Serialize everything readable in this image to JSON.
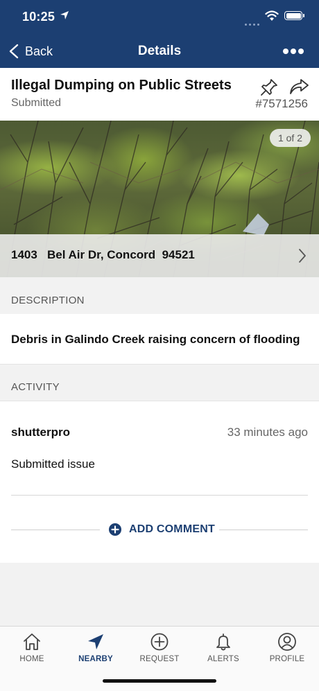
{
  "status_bar": {
    "time": "10:25"
  },
  "nav": {
    "back_label": "Back",
    "title": "Details"
  },
  "issue": {
    "title": "Illegal Dumping on Public Streets",
    "status": "Submitted",
    "ticket_number": "#7571256"
  },
  "photo": {
    "counter": "1 of 2",
    "address": "1403   Bel Air Dr, Concord  94521"
  },
  "description": {
    "label": "DESCRIPTION",
    "text": "Debris in Galindo Creek raising concern of flooding"
  },
  "activity": {
    "label": "ACTIVITY",
    "entries": [
      {
        "user": "shutterpro",
        "time": "33 minutes ago",
        "action": "Submitted issue"
      }
    ],
    "add_comment_label": "ADD COMMENT"
  },
  "tabs": [
    {
      "label": "HOME",
      "icon": "house-icon",
      "active": false
    },
    {
      "label": "NEARBY",
      "icon": "navigation-arrow-icon",
      "active": true
    },
    {
      "label": "REQUEST",
      "icon": "plus-circle-icon",
      "active": false
    },
    {
      "label": "ALERTS",
      "icon": "bell-icon",
      "active": false
    },
    {
      "label": "PROFILE",
      "icon": "user-circle-icon",
      "active": false
    }
  ],
  "colors": {
    "primary": "#1c3f72",
    "background": "#f2f2f2"
  }
}
